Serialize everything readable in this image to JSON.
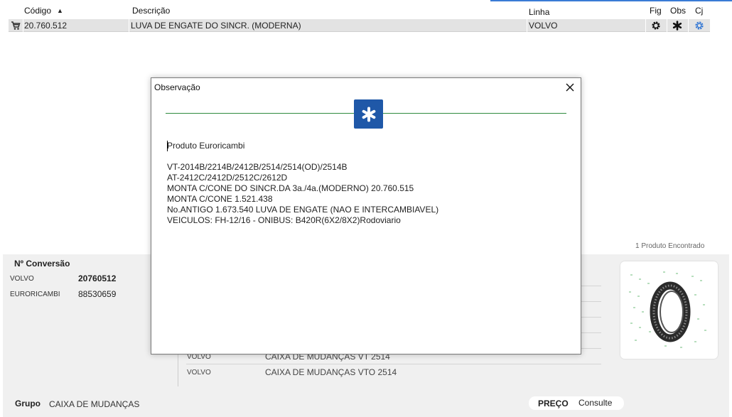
{
  "header": {
    "codigo": "Código",
    "descricao": "Descrição",
    "linha": "Linha",
    "fig": "Fig",
    "obs": "Obs",
    "cj": "Cj"
  },
  "product_row": {
    "codigo": "20.760.512",
    "descricao": "LUVA DE ENGATE DO SINCR. (MODERNA)",
    "linha": "VOLVO"
  },
  "results": {
    "found": "1 Produto Encontrado"
  },
  "conversion": {
    "title": "Nº Conversão",
    "rows": [
      {
        "brand": "VOLVO",
        "number": "20760512"
      },
      {
        "brand": "EURORICAMBI",
        "number": "88530659"
      }
    ]
  },
  "applications": [
    {
      "brand": "VOLVO",
      "description": "CAIXA DE MUDANÇAS VT 2514"
    },
    {
      "brand": "VOLVO",
      "description": "CAIXA DE MUDANÇAS VTO 2514"
    }
  ],
  "footer": {
    "grupo_label": "Grupo",
    "grupo_value": "CAIXA DE MUDANÇAS",
    "preco_label": "PREÇO",
    "preco_value": "Consulte"
  },
  "modal": {
    "title": "Observação",
    "heading": "Produto Euroricambi",
    "lines": [
      "VT-2014B/2214B/2412B/2514/2514(OD)/2514B",
      "AT-2412C/2412D/2512C/2612D",
      "MONTA C/CONE DO SINCR.DA 3a./4a.(MODERNO) 20.760.515",
      "MONTA C/CONE 1.521.438",
      "No.ANTIGO 1.673.540 LUVA DE ENGATE (NAO E INTERCAMBIAVEL)",
      "VEICULOS: FH-12/16 - ONIBUS: B420R(6X2/8X2)Rodoviario"
    ]
  },
  "colors": {
    "accent": "#1f58a8",
    "divider": "#2e8b3e",
    "link_icon": "#3a7bd5"
  },
  "icons": [
    "cart-icon",
    "sort-asc-icon",
    "gear-icon",
    "asterisk-icon",
    "sets-gear-icon",
    "close-icon",
    "product-image"
  ]
}
